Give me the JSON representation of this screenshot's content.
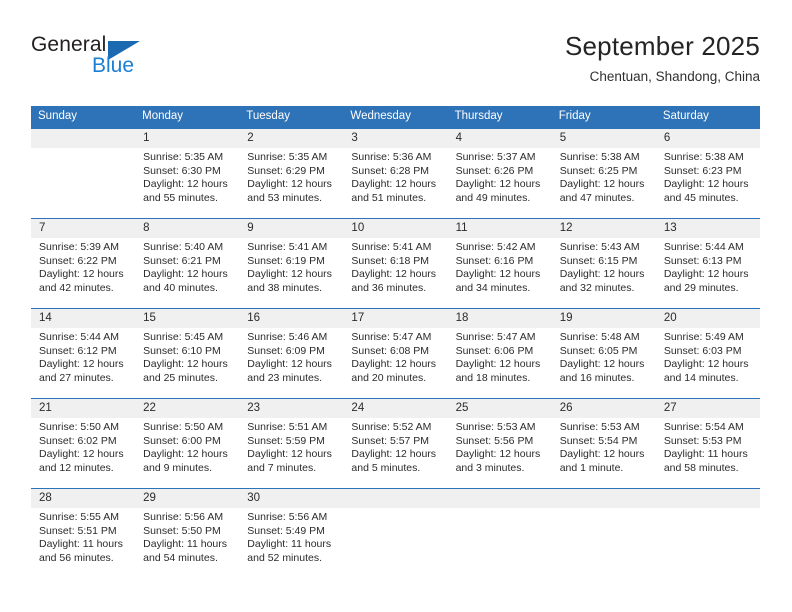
{
  "brand": {
    "general": "General",
    "blue": "Blue"
  },
  "header": {
    "title": "September 2025",
    "subtitle": "Chentuan, Shandong, China"
  },
  "colors": {
    "header_blue": "#2E72B8",
    "daynum_bg": "#F0F0F0",
    "brand_blue": "#1B7FD4"
  },
  "weekdays": [
    "Sunday",
    "Monday",
    "Tuesday",
    "Wednesday",
    "Thursday",
    "Friday",
    "Saturday"
  ],
  "weeks": [
    [
      {
        "day": "",
        "sunrise": "",
        "sunset": "",
        "daylight1": "",
        "daylight2": ""
      },
      {
        "day": "1",
        "sunrise": "Sunrise: 5:35 AM",
        "sunset": "Sunset: 6:30 PM",
        "daylight1": "Daylight: 12 hours",
        "daylight2": "and 55 minutes."
      },
      {
        "day": "2",
        "sunrise": "Sunrise: 5:35 AM",
        "sunset": "Sunset: 6:29 PM",
        "daylight1": "Daylight: 12 hours",
        "daylight2": "and 53 minutes."
      },
      {
        "day": "3",
        "sunrise": "Sunrise: 5:36 AM",
        "sunset": "Sunset: 6:28 PM",
        "daylight1": "Daylight: 12 hours",
        "daylight2": "and 51 minutes."
      },
      {
        "day": "4",
        "sunrise": "Sunrise: 5:37 AM",
        "sunset": "Sunset: 6:26 PM",
        "daylight1": "Daylight: 12 hours",
        "daylight2": "and 49 minutes."
      },
      {
        "day": "5",
        "sunrise": "Sunrise: 5:38 AM",
        "sunset": "Sunset: 6:25 PM",
        "daylight1": "Daylight: 12 hours",
        "daylight2": "and 47 minutes."
      },
      {
        "day": "6",
        "sunrise": "Sunrise: 5:38 AM",
        "sunset": "Sunset: 6:23 PM",
        "daylight1": "Daylight: 12 hours",
        "daylight2": "and 45 minutes."
      }
    ],
    [
      {
        "day": "7",
        "sunrise": "Sunrise: 5:39 AM",
        "sunset": "Sunset: 6:22 PM",
        "daylight1": "Daylight: 12 hours",
        "daylight2": "and 42 minutes."
      },
      {
        "day": "8",
        "sunrise": "Sunrise: 5:40 AM",
        "sunset": "Sunset: 6:21 PM",
        "daylight1": "Daylight: 12 hours",
        "daylight2": "and 40 minutes."
      },
      {
        "day": "9",
        "sunrise": "Sunrise: 5:41 AM",
        "sunset": "Sunset: 6:19 PM",
        "daylight1": "Daylight: 12 hours",
        "daylight2": "and 38 minutes."
      },
      {
        "day": "10",
        "sunrise": "Sunrise: 5:41 AM",
        "sunset": "Sunset: 6:18 PM",
        "daylight1": "Daylight: 12 hours",
        "daylight2": "and 36 minutes."
      },
      {
        "day": "11",
        "sunrise": "Sunrise: 5:42 AM",
        "sunset": "Sunset: 6:16 PM",
        "daylight1": "Daylight: 12 hours",
        "daylight2": "and 34 minutes."
      },
      {
        "day": "12",
        "sunrise": "Sunrise: 5:43 AM",
        "sunset": "Sunset: 6:15 PM",
        "daylight1": "Daylight: 12 hours",
        "daylight2": "and 32 minutes."
      },
      {
        "day": "13",
        "sunrise": "Sunrise: 5:44 AM",
        "sunset": "Sunset: 6:13 PM",
        "daylight1": "Daylight: 12 hours",
        "daylight2": "and 29 minutes."
      }
    ],
    [
      {
        "day": "14",
        "sunrise": "Sunrise: 5:44 AM",
        "sunset": "Sunset: 6:12 PM",
        "daylight1": "Daylight: 12 hours",
        "daylight2": "and 27 minutes."
      },
      {
        "day": "15",
        "sunrise": "Sunrise: 5:45 AM",
        "sunset": "Sunset: 6:10 PM",
        "daylight1": "Daylight: 12 hours",
        "daylight2": "and 25 minutes."
      },
      {
        "day": "16",
        "sunrise": "Sunrise: 5:46 AM",
        "sunset": "Sunset: 6:09 PM",
        "daylight1": "Daylight: 12 hours",
        "daylight2": "and 23 minutes."
      },
      {
        "day": "17",
        "sunrise": "Sunrise: 5:47 AM",
        "sunset": "Sunset: 6:08 PM",
        "daylight1": "Daylight: 12 hours",
        "daylight2": "and 20 minutes."
      },
      {
        "day": "18",
        "sunrise": "Sunrise: 5:47 AM",
        "sunset": "Sunset: 6:06 PM",
        "daylight1": "Daylight: 12 hours",
        "daylight2": "and 18 minutes."
      },
      {
        "day": "19",
        "sunrise": "Sunrise: 5:48 AM",
        "sunset": "Sunset: 6:05 PM",
        "daylight1": "Daylight: 12 hours",
        "daylight2": "and 16 minutes."
      },
      {
        "day": "20",
        "sunrise": "Sunrise: 5:49 AM",
        "sunset": "Sunset: 6:03 PM",
        "daylight1": "Daylight: 12 hours",
        "daylight2": "and 14 minutes."
      }
    ],
    [
      {
        "day": "21",
        "sunrise": "Sunrise: 5:50 AM",
        "sunset": "Sunset: 6:02 PM",
        "daylight1": "Daylight: 12 hours",
        "daylight2": "and 12 minutes."
      },
      {
        "day": "22",
        "sunrise": "Sunrise: 5:50 AM",
        "sunset": "Sunset: 6:00 PM",
        "daylight1": "Daylight: 12 hours",
        "daylight2": "and 9 minutes."
      },
      {
        "day": "23",
        "sunrise": "Sunrise: 5:51 AM",
        "sunset": "Sunset: 5:59 PM",
        "daylight1": "Daylight: 12 hours",
        "daylight2": "and 7 minutes."
      },
      {
        "day": "24",
        "sunrise": "Sunrise: 5:52 AM",
        "sunset": "Sunset: 5:57 PM",
        "daylight1": "Daylight: 12 hours",
        "daylight2": "and 5 minutes."
      },
      {
        "day": "25",
        "sunrise": "Sunrise: 5:53 AM",
        "sunset": "Sunset: 5:56 PM",
        "daylight1": "Daylight: 12 hours",
        "daylight2": "and 3 minutes."
      },
      {
        "day": "26",
        "sunrise": "Sunrise: 5:53 AM",
        "sunset": "Sunset: 5:54 PM",
        "daylight1": "Daylight: 12 hours",
        "daylight2": "and 1 minute."
      },
      {
        "day": "27",
        "sunrise": "Sunrise: 5:54 AM",
        "sunset": "Sunset: 5:53 PM",
        "daylight1": "Daylight: 11 hours",
        "daylight2": "and 58 minutes."
      }
    ],
    [
      {
        "day": "28",
        "sunrise": "Sunrise: 5:55 AM",
        "sunset": "Sunset: 5:51 PM",
        "daylight1": "Daylight: 11 hours",
        "daylight2": "and 56 minutes."
      },
      {
        "day": "29",
        "sunrise": "Sunrise: 5:56 AM",
        "sunset": "Sunset: 5:50 PM",
        "daylight1": "Daylight: 11 hours",
        "daylight2": "and 54 minutes."
      },
      {
        "day": "30",
        "sunrise": "Sunrise: 5:56 AM",
        "sunset": "Sunset: 5:49 PM",
        "daylight1": "Daylight: 11 hours",
        "daylight2": "and 52 minutes."
      },
      {
        "day": "",
        "sunrise": "",
        "sunset": "",
        "daylight1": "",
        "daylight2": ""
      },
      {
        "day": "",
        "sunrise": "",
        "sunset": "",
        "daylight1": "",
        "daylight2": ""
      },
      {
        "day": "",
        "sunrise": "",
        "sunset": "",
        "daylight1": "",
        "daylight2": ""
      },
      {
        "day": "",
        "sunrise": "",
        "sunset": "",
        "daylight1": "",
        "daylight2": ""
      }
    ]
  ]
}
